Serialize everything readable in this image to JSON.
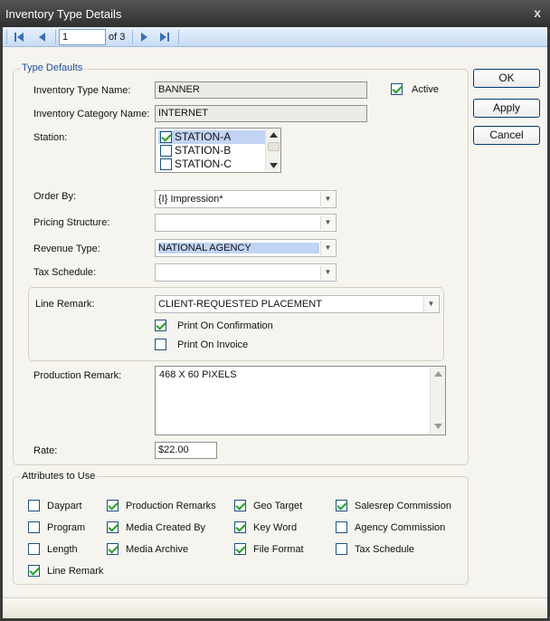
{
  "window": {
    "title": "Inventory Type Details",
    "close": "x"
  },
  "nav": {
    "page_value": "1",
    "of_label": "of 3"
  },
  "type_defaults": {
    "legend": "Type Defaults",
    "inv_type_name_label": "Inventory Type Name:",
    "inv_type_name_value": "BANNER",
    "active_label": "Active",
    "active_checked": true,
    "inv_category_label": "Inventory Category Name:",
    "inv_category_value": "INTERNET",
    "station_label": "Station:",
    "stations": [
      {
        "label": "STATION-A",
        "checked": true
      },
      {
        "label": "STATION-B",
        "checked": false
      },
      {
        "label": "STATION-C",
        "checked": false
      }
    ],
    "order_by_label": "Order By:",
    "order_by_value": "{I} Impression*",
    "pricing_label": "Pricing Structure:",
    "pricing_value": "",
    "revenue_label": "Revenue Type:",
    "revenue_value": "NATIONAL AGENCY",
    "tax_label": "Tax Schedule:",
    "tax_value": "",
    "line_remark_label": "Line Remark:",
    "line_remark_value": "CLIENT-REQUESTED PLACEMENT",
    "print_confirmation_label": "Print On Confirmation",
    "print_invoice_label": "Print On Invoice",
    "production_remark_label": "Production Remark:",
    "production_remark_value": "468 X 60 PIXELS",
    "rate_label": "Rate:",
    "rate_value": "$22.00"
  },
  "buttons": {
    "ok": "OK",
    "apply": "Apply",
    "cancel": "Cancel"
  },
  "attributes": {
    "legend": "Attributes to Use",
    "items": [
      {
        "label": "Daypart",
        "checked": false
      },
      {
        "label": "Program",
        "checked": false
      },
      {
        "label": "Length",
        "checked": false
      },
      {
        "label": "Line Remark",
        "checked": true
      },
      {
        "label": "Production Remarks",
        "checked": true
      },
      {
        "label": "Media Created By",
        "checked": true
      },
      {
        "label": "Media Archive",
        "checked": true
      },
      {
        "label": "Geo Target",
        "checked": true
      },
      {
        "label": "Key Word",
        "checked": true
      },
      {
        "label": "File Format",
        "checked": true
      },
      {
        "label": "Salesrep Commission",
        "checked": true
      },
      {
        "label": "Agency Commission",
        "checked": false
      },
      {
        "label": "Tax Schedule",
        "checked": false
      }
    ]
  }
}
